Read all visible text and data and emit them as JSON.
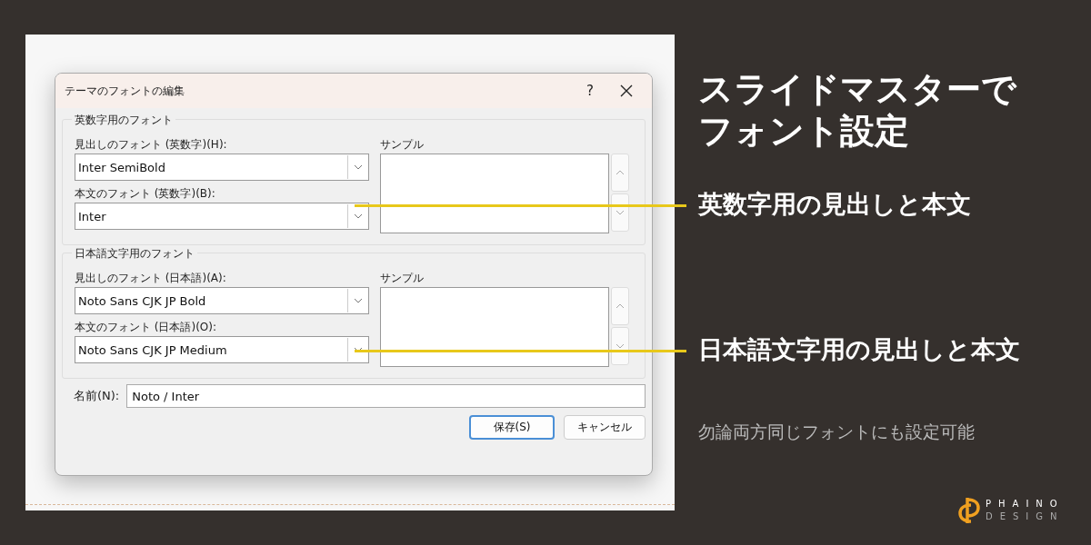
{
  "slide": {
    "title_lines": [
      "スライドマスターで",
      "フォント設定"
    ],
    "callouts": [
      "英数字用の見出しと本文",
      "日本語文字用の見出しと本文"
    ],
    "note": "勿論両方同じフォントにも設定可能",
    "logo": {
      "name": "PHAINO",
      "tagline": "DESIGN"
    }
  },
  "dialog": {
    "title": "テーマのフォントの編集",
    "help": "?",
    "groups": [
      {
        "legend": "英数字用のフォント",
        "sample_label": "サンプル",
        "fields": [
          {
            "label": "見出しのフォント (英数字)(H):",
            "value": "Inter SemiBold"
          },
          {
            "label": "本文のフォント (英数字)(B):",
            "value": "Inter"
          }
        ]
      },
      {
        "legend": "日本語文字用のフォント",
        "sample_label": "サンプル",
        "fields": [
          {
            "label": "見出しのフォント (日本語)(A):",
            "value": "Noto Sans CJK JP Bold"
          },
          {
            "label": "本文のフォント (日本語)(O):",
            "value": "Noto Sans CJK JP Medium"
          }
        ]
      }
    ],
    "name_field": {
      "label": "名前(N):",
      "value": "Noto / Inter"
    },
    "buttons": [
      {
        "label": "保存(S)",
        "default": true
      },
      {
        "label": "キャンセル",
        "default": false
      }
    ]
  }
}
